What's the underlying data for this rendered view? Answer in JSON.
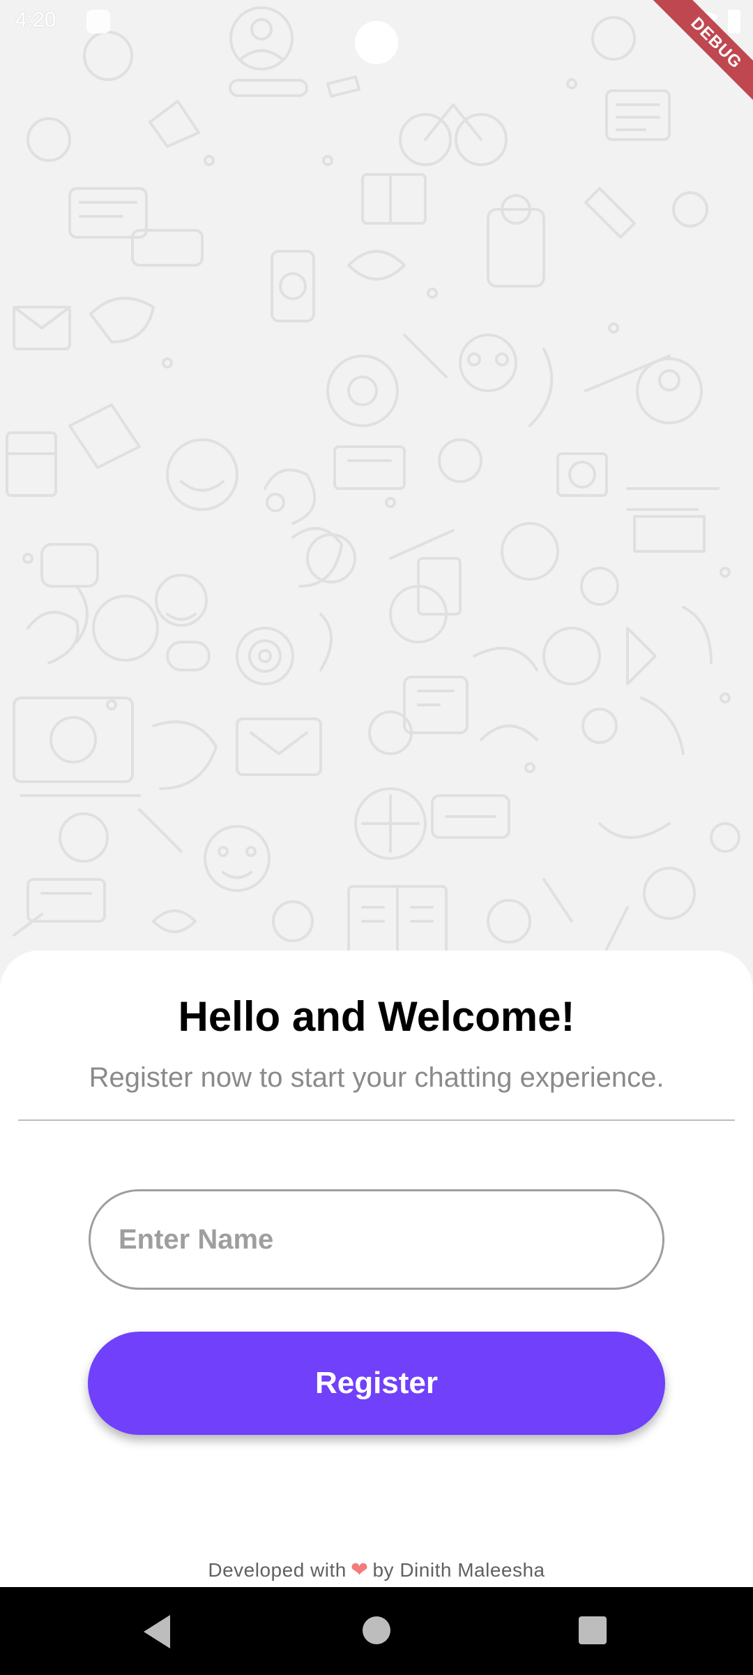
{
  "status_bar": {
    "time": "4:20"
  },
  "debug_banner": {
    "label": "DEBUG"
  },
  "welcome": {
    "title": "Hello and Welcome!",
    "subtitle": "Register now to start your chatting experience."
  },
  "form": {
    "name_placeholder": "Enter Name",
    "name_value": "",
    "register_label": "Register"
  },
  "footer": {
    "prefix": "Developed with",
    "suffix": "by Dinith Maleesha",
    "heart_icon": "heart-icon"
  },
  "nav": {
    "back_icon": "back-icon",
    "home_icon": "home-icon",
    "recents_icon": "recents-icon"
  },
  "colors": {
    "accent": "#7040fb",
    "background_pattern": "#f2f2f2",
    "heart": "#f27b7b"
  }
}
